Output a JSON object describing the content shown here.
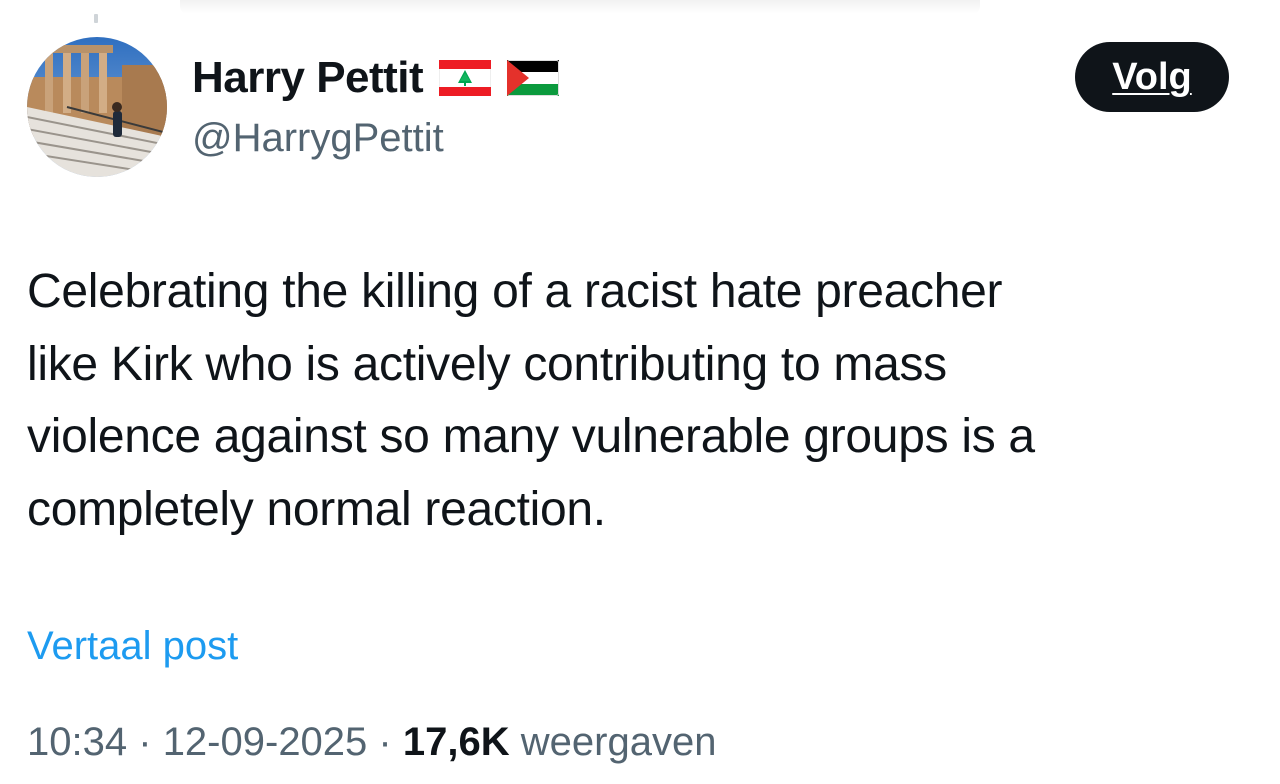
{
  "author": {
    "display_name": "Harry Pettit",
    "handle": "@HarrygPettit",
    "flags": [
      "lebanon-flag",
      "palestine-flag"
    ]
  },
  "follow_button": {
    "label": "Volg"
  },
  "post": {
    "lines": [
      "Celebrating the killing of a racist hate preacher",
      "like Kirk who is actively contributing to mass",
      "violence against so many vulnerable groups is a",
      "completely normal reaction."
    ]
  },
  "translate_link": {
    "label": "Vertaal post"
  },
  "meta": {
    "time": "10:34",
    "separator": "·",
    "date": "12-09-2025",
    "views_count": "17,6K",
    "views_label": "weergaven"
  },
  "colors": {
    "text_primary": "#0f1419",
    "text_secondary": "#536471",
    "link": "#1d9bf0",
    "button_bg": "#0f1419",
    "button_text": "#ffffff",
    "background": "#ffffff"
  }
}
